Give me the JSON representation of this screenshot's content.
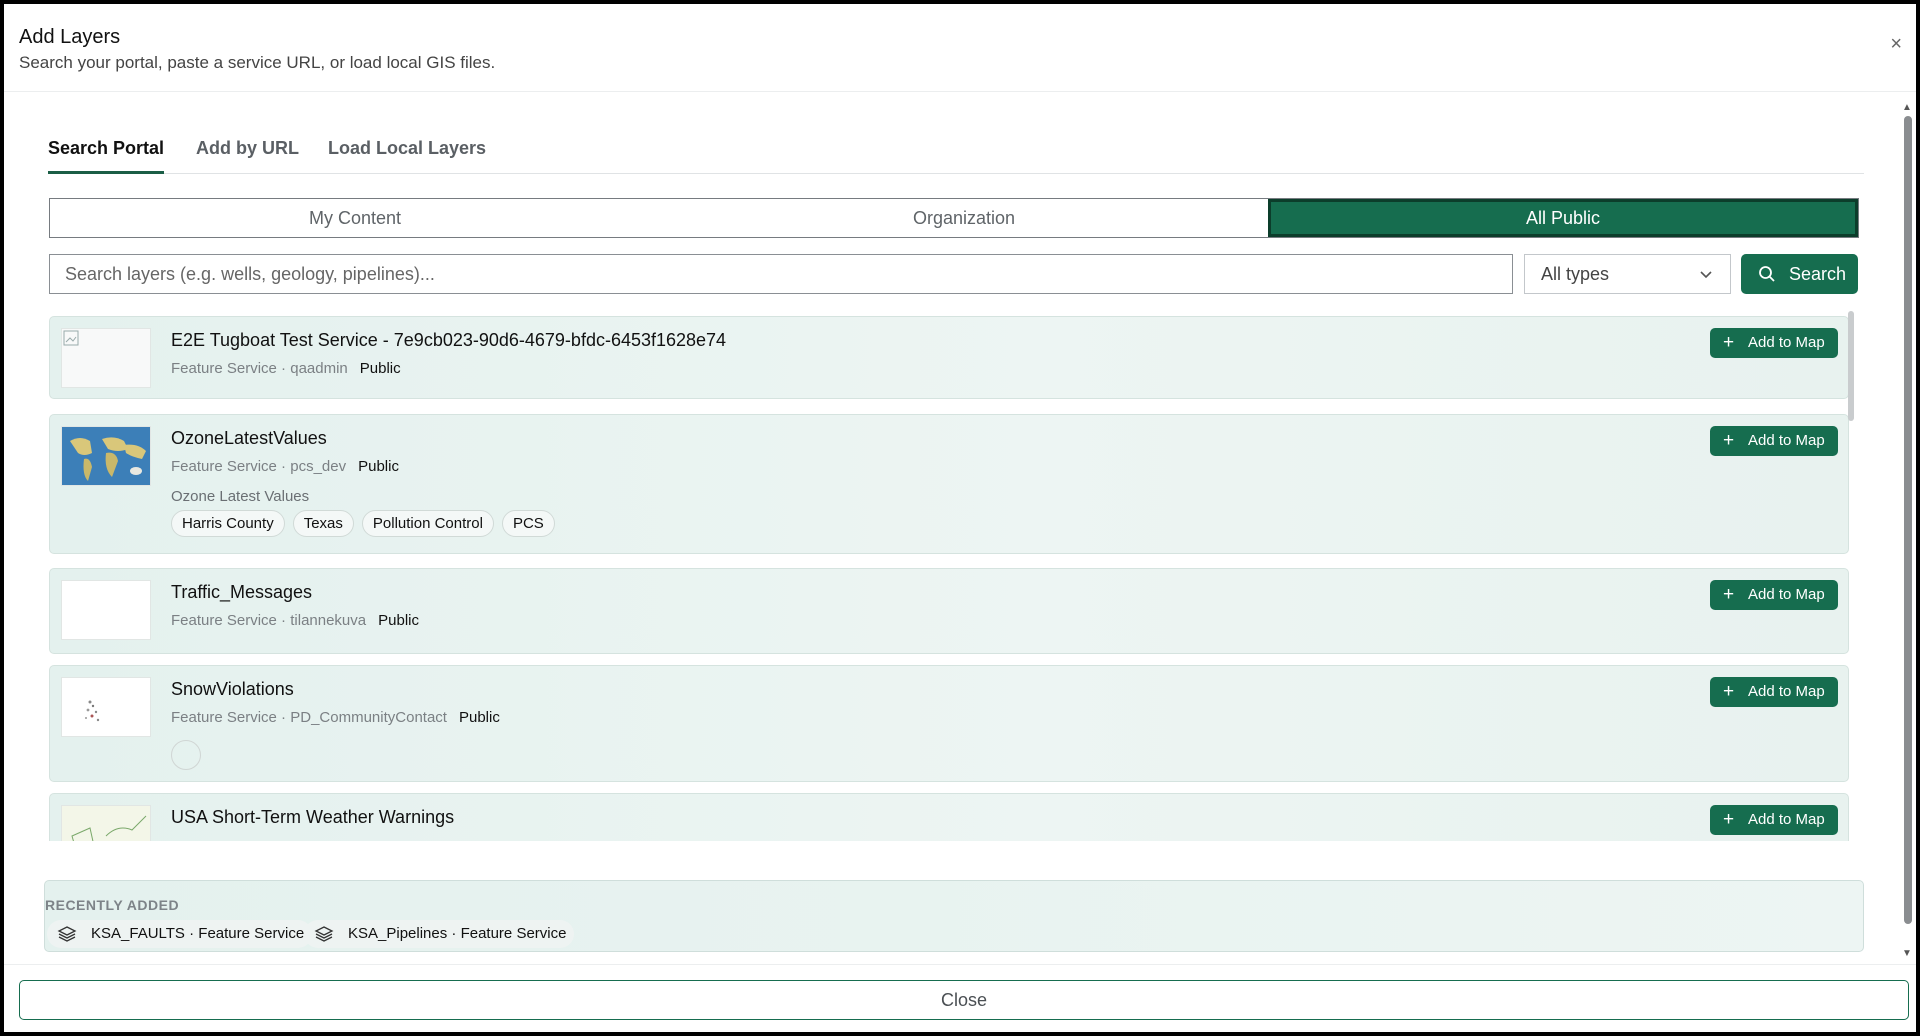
{
  "dialog": {
    "title": "Add Layers",
    "subtitle": "Search your portal, paste a service URL, or load local GIS files.",
    "close_glyph": "×"
  },
  "tabs": [
    {
      "label": "Search Portal",
      "active": true
    },
    {
      "label": "Add by URL",
      "active": false
    },
    {
      "label": "Load Local Layers",
      "active": false
    }
  ],
  "scope": [
    {
      "label": "My Content",
      "active": false
    },
    {
      "label": "Organization",
      "active": false
    },
    {
      "label": "All Public",
      "active": true
    }
  ],
  "search": {
    "placeholder": "Search layers (e.g. wells, geology, pipelines)...",
    "value": "",
    "type_filter": "All types",
    "button_label": "Search"
  },
  "results": [
    {
      "title": "E2E Tugboat Test Service - 7e9cb023-90d6-4679-bfdc-6453f1628e74",
      "type": "Feature Service",
      "owner": "qaadmin",
      "access": "Public",
      "add_label": "Add to Map"
    },
    {
      "title": "OzoneLatestValues",
      "type": "Feature Service",
      "owner": "pcs_dev",
      "access": "Public",
      "description": "Ozone Latest Values",
      "tags": [
        "Harris County",
        "Texas",
        "Pollution Control",
        "PCS"
      ],
      "add_label": "Add to Map"
    },
    {
      "title": "Traffic_Messages",
      "type": "Feature Service",
      "owner": "tilannekuva",
      "access": "Public",
      "add_label": "Add to Map"
    },
    {
      "title": "SnowViolations",
      "type": "Feature Service",
      "owner": "PD_CommunityContact",
      "access": "Public",
      "add_label": "Add to Map"
    },
    {
      "title": "USA Short-Term Weather Warnings",
      "add_label": "Add to Map"
    }
  ],
  "recent": {
    "label": "RECENTLY ADDED",
    "items": [
      {
        "name": "KSA_FAULTS",
        "type": "Feature Service"
      },
      {
        "name": "KSA_Pipelines",
        "type": "Feature Service"
      }
    ]
  },
  "footer": {
    "close_label": "Close"
  },
  "colors": {
    "accent": "#166d4f",
    "card_bg": "#e8f2ef"
  }
}
